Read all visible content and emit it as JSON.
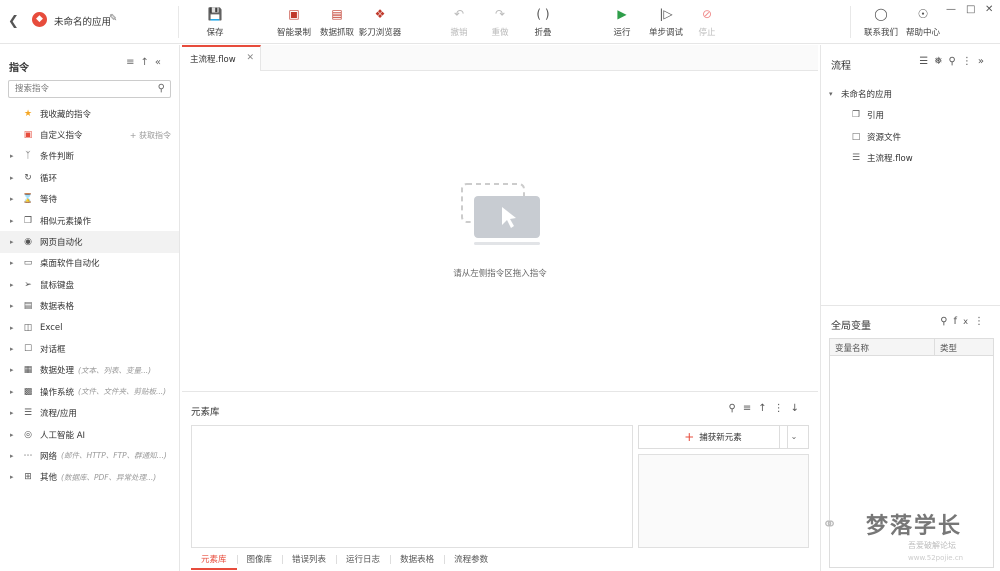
{
  "header": {
    "back_icon": "chevron-left-icon",
    "app_name": "未命名的应用",
    "toolbar": {
      "save": "保存",
      "smart_record": "智能录制",
      "data_capture": "数据抓取",
      "shadow_browser": "影刀浏览器",
      "undo": "撤销",
      "redo": "重做",
      "fold": "折叠",
      "run": "运行",
      "step_debug": "单步调试",
      "stop": "停止",
      "contact": "联系我们",
      "help": "帮助中心"
    },
    "accent_color": "#e74c3c",
    "run_color": "#2e9e4a"
  },
  "left_panel": {
    "title": "指令",
    "search_placeholder": "搜索指令",
    "fetch_label": "+ 获取指令",
    "items": [
      {
        "label": "我收藏的指令",
        "hint": "",
        "icon": "star-icon"
      },
      {
        "label": "自定义指令",
        "hint": "",
        "icon": "custom-icon"
      },
      {
        "label": "条件判断",
        "hint": "",
        "icon": "branch-icon"
      },
      {
        "label": "循环",
        "hint": "",
        "icon": "loop-icon"
      },
      {
        "label": "等待",
        "hint": "",
        "icon": "hourglass-icon"
      },
      {
        "label": "相似元素操作",
        "hint": "",
        "icon": "copy-icon"
      },
      {
        "label": "网页自动化",
        "hint": "",
        "icon": "globe-icon"
      },
      {
        "label": "桌面软件自动化",
        "hint": "",
        "icon": "monitor-icon"
      },
      {
        "label": "鼠标键盘",
        "hint": "",
        "icon": "cursor-icon"
      },
      {
        "label": "数据表格",
        "hint": "",
        "icon": "table-icon"
      },
      {
        "label": "Excel",
        "hint": "",
        "icon": "excel-icon"
      },
      {
        "label": "对话框",
        "hint": "",
        "icon": "dialog-icon"
      },
      {
        "label": "数据处理",
        "hint": "(文本、列表、变量...)",
        "icon": "data-process-icon"
      },
      {
        "label": "操作系统",
        "hint": "(文件、文件夹、剪贴板...)",
        "icon": "os-icon"
      },
      {
        "label": "流程/应用",
        "hint": "",
        "icon": "layers-icon"
      },
      {
        "label": "人工智能 AI",
        "hint": "",
        "icon": "ai-icon"
      },
      {
        "label": "网络",
        "hint": "(邮件、HTTP、FTP、群通知...)",
        "icon": "network-icon"
      },
      {
        "label": "其他",
        "hint": "(数据库、PDF、异常处理...)",
        "icon": "other-icon"
      }
    ]
  },
  "center": {
    "tab_label": "主流程.flow",
    "empty_hint": "请从左侧指令区拖入指令",
    "element_panel": {
      "title": "元素库",
      "capture_label": "捕获新元素",
      "tabs": [
        "元素库",
        "图像库",
        "错误列表",
        "运行日志",
        "数据表格",
        "流程参数"
      ]
    }
  },
  "right_panel": {
    "title": "流程",
    "tree_root": "未命名的应用",
    "tree_children": [
      {
        "label": "引用",
        "icon": "reference-icon"
      },
      {
        "label": "资源文件",
        "icon": "file-icon"
      },
      {
        "label": "主流程.flow",
        "icon": "flow-icon"
      }
    ],
    "globals_title": "全局变量",
    "globals_columns": [
      "变量名称",
      "类型"
    ]
  },
  "watermark": {
    "name": "梦落学长",
    "sub": "吾爱破解论坛",
    "url": "www.52pojie.cn"
  }
}
